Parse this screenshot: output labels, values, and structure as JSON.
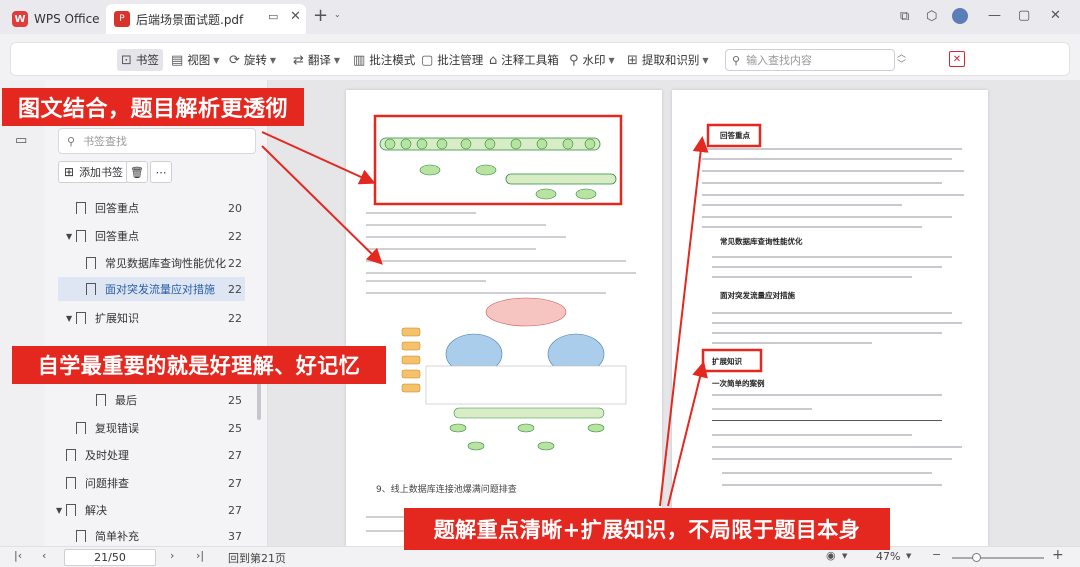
{
  "window": {
    "app_tab": "WPS Office",
    "doc_tab": "后端场景面试题.pdf"
  },
  "toolbar": {
    "bookmark": "书签",
    "view": "视图",
    "rotate": "旋转",
    "translate": "翻译",
    "annot_mode": "批注模式",
    "annot_manage": "批注管理",
    "toolbox": "注释工具箱",
    "watermark": "水印",
    "extract": "提取和识别",
    "search_placeholder": "输入查找内容"
  },
  "sidebar": {
    "search_placeholder": "书签查找",
    "add_bookmark": "添加书签",
    "items": [
      {
        "label": "回答重点",
        "page": "20"
      },
      {
        "label": "回答重点",
        "page": "22"
      },
      {
        "label": "常见数据库查询性能优化",
        "page": "22"
      },
      {
        "label": "面对突发流量应对措施",
        "page": "22"
      },
      {
        "label": "扩展知识",
        "page": "22"
      },
      {
        "label": "最后",
        "page": "25"
      },
      {
        "label": "复现错误",
        "page": "25"
      },
      {
        "label": "及时处理",
        "page": "27"
      },
      {
        "label": "问题排查",
        "page": "27"
      },
      {
        "label": "解决",
        "page": "27"
      },
      {
        "label": "简单补充",
        "page": "37"
      }
    ]
  },
  "doc": {
    "left_heading": "9、线上数据库连接池爆满问题排查",
    "right": {
      "h1": "回答重点",
      "h2": "常见数据库查询性能优化",
      "h3": "面对突发流量应对措施",
      "h4": "扩展知识",
      "h5": "一次简单的案例"
    }
  },
  "status": {
    "page_input": "21/50",
    "back_label": "回到第21页",
    "zoom": "47%"
  },
  "annotations": {
    "top_left": "图文结合，题目解析更透彻",
    "mid_left": "自学最重要的就是好理解、好记忆",
    "bottom": "题解重点清晰+扩展知识，不局限于题目本身"
  },
  "colors": {
    "accent_red": "#e5281f",
    "active_bookmark": "#dde6f2"
  }
}
